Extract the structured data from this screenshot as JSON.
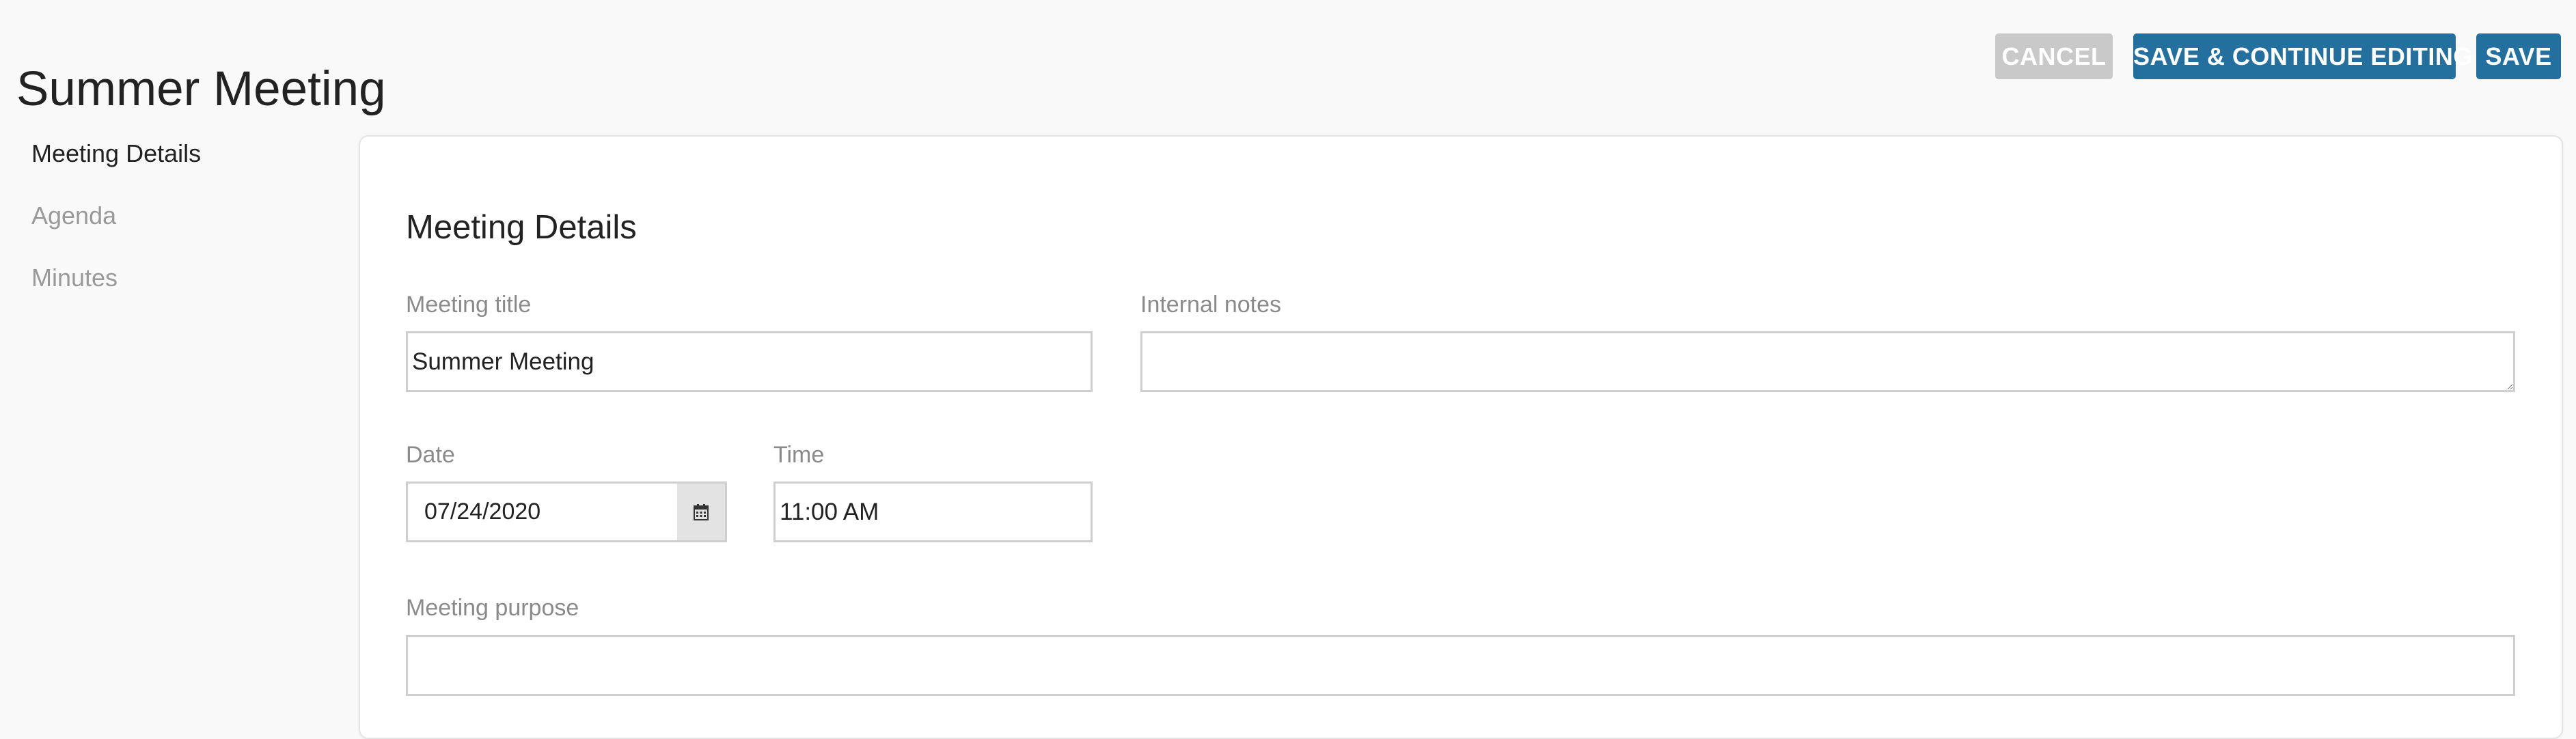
{
  "header": {
    "title": "Summer Meeting",
    "cancel_label": "CANCEL",
    "save_continue_label": "SAVE & CONTINUE EDITING",
    "save_label": "SAVE"
  },
  "sidebar": {
    "items": [
      {
        "label": "Meeting Details",
        "active": true
      },
      {
        "label": "Agenda",
        "active": false
      },
      {
        "label": "Minutes",
        "active": false
      }
    ]
  },
  "form": {
    "heading": "Meeting Details",
    "meeting_title": {
      "label": "Meeting title",
      "value": "Summer Meeting"
    },
    "internal_notes": {
      "label": "Internal notes",
      "value": ""
    },
    "date": {
      "label": "Date",
      "value": "07/24/2020",
      "icon": "calendar-icon"
    },
    "time": {
      "label": "Time",
      "value": "11:00 AM"
    },
    "meeting_purpose": {
      "label": "Meeting purpose",
      "value": ""
    }
  },
  "colors": {
    "primary": "#23709f",
    "cancel": "#c9c9c9",
    "background": "#f9f9f9"
  }
}
